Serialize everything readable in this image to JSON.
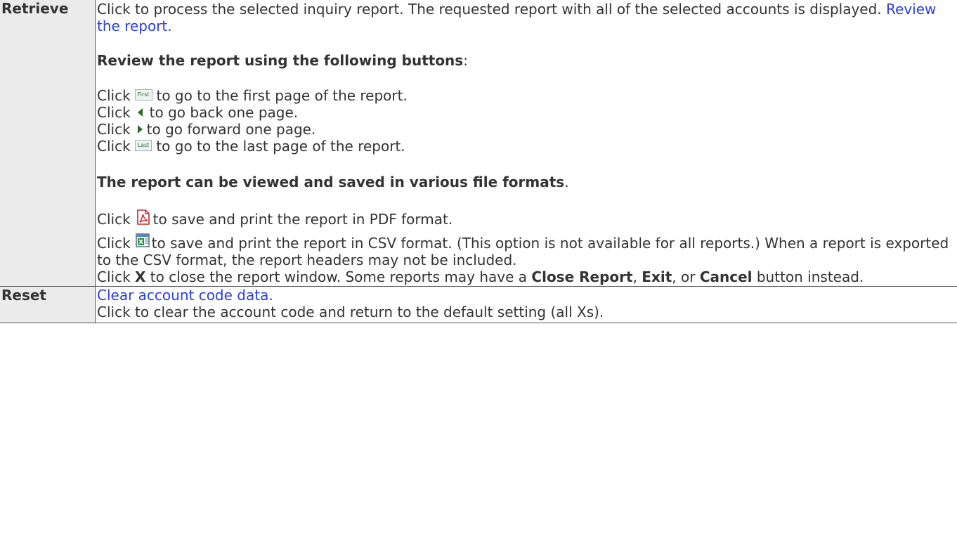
{
  "rows": [
    {
      "term": "Retrieve",
      "intro": "Click to process the selected inquiry report. The requested report with all of the selected accounts is displayed.",
      "intro_link": "Review the report.",
      "review_heading": "Review the report using the following buttons",
      "review_heading_suffix": ":",
      "click_word": "Click",
      "nav_first_label": "First",
      "nav_first_text": "to go to the first page of the report.",
      "nav_back_text": "to go back one page.",
      "nav_forward_text": "to go forward one page.",
      "nav_last_label": "Last",
      "nav_last_text": "to go to the last page of the report.",
      "formats_heading": "The report can be viewed and saved in various file formats",
      "formats_heading_suffix": ".",
      "pdf_text": "to save and print the report in PDF format.",
      "csv_text": "to save and print the report in CSV format. (This option is not available for all reports.) When a report is exported to the CSV format, the report headers may not be included.",
      "close_x": "X",
      "close_text_1": "to close the report window. Some reports may have a",
      "close_report": "Close Report",
      "close_comma": ",",
      "exit": "Exit",
      "close_or": ", or",
      "cancel": "Cancel",
      "close_text_2": "button instead."
    },
    {
      "term": "Reset",
      "link": "Clear account code data.",
      "text": "Click to clear the account code and return to the default setting (all Xs)."
    }
  ],
  "icons": {
    "first": "first-page-button-icon",
    "back": "previous-page-arrow-icon",
    "forward": "next-page-arrow-icon",
    "last": "last-page-button-icon",
    "pdf": "pdf-icon",
    "csv": "csv-excel-icon"
  },
  "colors": {
    "link": "#2b3fd8",
    "text": "#333333",
    "border": "#555555",
    "term_highlight": "#ebebeb"
  }
}
